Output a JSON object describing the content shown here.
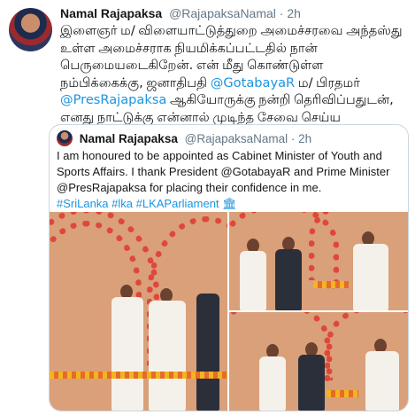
{
  "tweet": {
    "author_name": "Namal Rajapaksa",
    "author_handle": "@RajapaksaNamal",
    "separator": "·",
    "time": "2h",
    "text_parts": {
      "p1": "இளைஞர் ம/ விளையாட்டுத்துறை அமைச்சரவை அந்தஸ்து உள்ள அமைச்சராக நியமிக்கப்பட்டதில் நான் பெருமையடைகிறேன். என் மீது கொண்டுள்ள நம்பிக்கைக்கு, ஜனாதிபதி ",
      "m1": "@GotabayaR",
      "p2": " ம/ பிரதமர் ",
      "m2": "@PresRajapaksa",
      "p3": " ஆகியோருக்கு நன்றி தெரிவிப்பதுடன், எனது நாட்டுக்கு என்னால் முடிந்த சேவை செய்ய எதிர்பார்க்கிறேன்."
    }
  },
  "quoted": {
    "author_name": "Namal Rajapaksa",
    "author_handle": "@RajapaksaNamal",
    "separator": "·",
    "time": "2h",
    "text": "I am honoured to be appointed as Cabinet Minister of Youth and Sports Affairs. I thank President @GotabayaR and Prime Minister @PresRajapaksa for placing their confidence in me.",
    "hashtags": "#SriLanka #lka #LKAParliament 🏛"
  },
  "colors": {
    "link": "#1b95e0",
    "muted": "#657786",
    "border": "#ccd6dd",
    "arch_red": "#e0473b"
  }
}
